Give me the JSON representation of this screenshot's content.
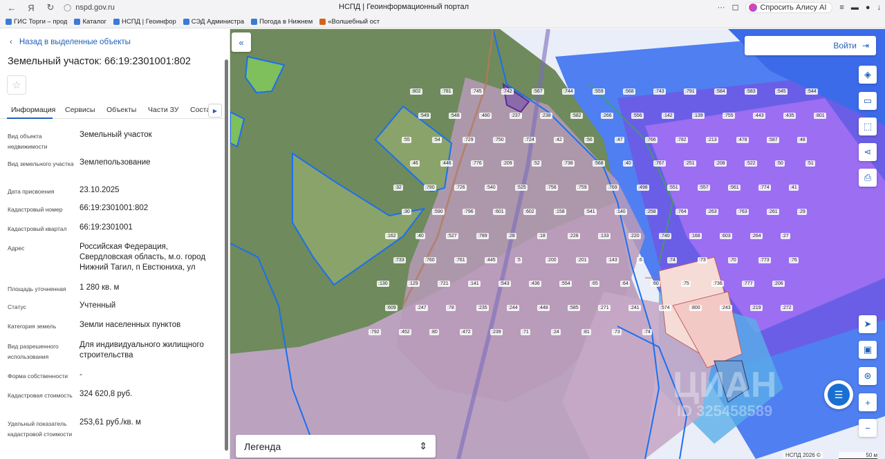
{
  "browser": {
    "url": "nspd.gov.ru",
    "title": "НСПД | Геоинформационный портал",
    "alice_label": "Спросить Алису AI",
    "bookmarks": [
      "ГИС Торги – прод",
      "Каталог",
      "НСПД | Геоинфор",
      "СЭД Администра",
      "Погода в Нижнем",
      "«Волшебный ост"
    ]
  },
  "panel": {
    "back_label": "Назад в выделенные объекты",
    "title": "Земельный участок: 66:19:2301001:802",
    "tabs": [
      "Информация",
      "Сервисы",
      "Объекты",
      "Части ЗУ",
      "Соста"
    ],
    "fields": [
      {
        "key": "Вид объекта недвижимости",
        "value": "Земельный участок"
      },
      {
        "key": "Вид земельного участка",
        "value": "Землепользование"
      },
      {
        "key": "Дата присвоения",
        "value": "23.10.2025"
      },
      {
        "key": "Кадастровый номер",
        "value": "66:19:2301001:802"
      },
      {
        "key": "Кадастровый квартал",
        "value": "66:19:2301001"
      },
      {
        "key": "Адрес",
        "value": "Российская Федерация, Свердловская область, м.о. город Нижний Тагил, п Евстюниха, ул"
      },
      {
        "key": "Площадь уточненная",
        "value": "1 280 кв. м"
      },
      {
        "key": "Статус",
        "value": "Учтенный"
      },
      {
        "key": "Категория земель",
        "value": "Земли населенных пунктов"
      },
      {
        "key": "Вид разрешенного использования",
        "value": "Для индивидуального жилищного строительства"
      },
      {
        "key": "Форма собственности",
        "value": "-"
      },
      {
        "key": "Кадастровая стоимость",
        "value": "324 620,8 руб."
      },
      {
        "key": "Удельный показатель кадастровой стоимости",
        "value": "253,61 руб./кв. м"
      }
    ]
  },
  "map": {
    "login_label": "Войти",
    "legend_label": "Легенда",
    "copyright": "НСПД 2026 ©",
    "scale_label": "50 м",
    "watermark": "ЦИАН",
    "watermark_id": "ID 325458589",
    "parcel_labels": [
      ":802",
      ":781",
      ":745",
      ":742",
      ":567",
      ":744",
      ":559",
      ":568",
      ":743",
      ":791",
      ":584",
      ":583",
      ":545",
      ":544",
      ":549",
      ":548",
      ":480",
      ":237",
      ":238",
      ":582",
      ":266",
      ":556",
      ":142",
      ":139",
      ":755",
      ":443",
      ":435",
      ":801",
      ":55",
      ":54",
      ":729",
      ":750",
      ":724",
      ":42",
      ":56",
      ":47",
      ":766",
      ":782",
      ":213",
      ":478",
      ":587",
      ":48",
      ":46",
      ":446",
      ":776",
      ":209",
      ":52",
      ":738",
      ":568",
      ":40",
      ":767",
      ":251",
      ":208",
      ":522",
      ":50",
      ":51",
      ":32",
      ":780",
      ":726",
      ":540",
      ":525",
      ":758",
      ":759",
      ":769",
      ":498",
      ":551",
      ":557",
      ":561",
      ":774",
      ":41",
      ":30",
      ":590",
      ":796",
      ":601",
      ":602",
      ":158",
      ":541",
      ":140",
      ":258",
      ":764",
      ":263",
      ":763",
      ":261",
      ":29",
      ":162",
      ":40",
      ":527",
      ":789",
      ":28",
      ":18",
      ":228",
      ":133",
      ":220",
      ":740",
      ":168",
      ":603",
      ":264",
      ":27",
      ":733",
      ":760",
      ":761",
      ":445",
      ":5",
      ":200",
      ":201",
      ":143",
      ":6",
      ":74",
      ":73",
      ":70",
      ":773",
      ":76",
      ":130",
      ":129",
      ":721",
      ":141",
      ":543",
      ":436",
      ":554",
      ":65",
      ":64",
      ":60",
      ":75",
      ":736",
      ":777",
      ":206",
      ":609",
      ":247",
      ":78",
      ":235",
      ":244",
      ":448",
      ":585",
      ":271",
      ":241",
      ":574",
      ":800",
      ":243",
      ":219",
      ":272",
      ":792",
      ":452",
      ":80",
      ":472",
      ":239",
      ":71",
      ":24",
      ":81",
      ":73",
      ":74"
    ]
  }
}
